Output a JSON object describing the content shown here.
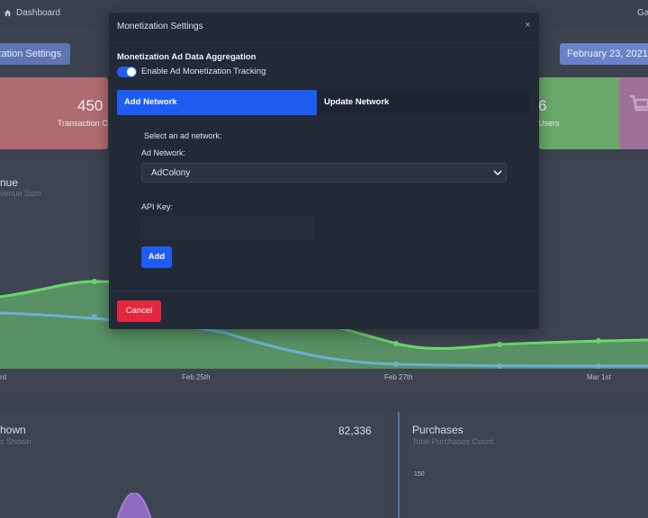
{
  "topbar": {
    "breadcrumb": "Dashboard",
    "right_text": "Ga"
  },
  "toolbar": {
    "aggregation_button": "zation Settings",
    "date_button": "February 23, 2021 - "
  },
  "cards": {
    "transactions": {
      "value": "450",
      "label": "Transaction C"
    },
    "users": {
      "value": "6",
      "label": "Users"
    }
  },
  "revenue_chart": {
    "title": "nue",
    "subtitle": "venue Sum",
    "x_labels": [
      "rd",
      "Feb 25th",
      "Feb 27th",
      "Mar 1st"
    ]
  },
  "shown_panel": {
    "title": "hown",
    "subtitle": "s Shown",
    "value": "82,336"
  },
  "purchases_panel": {
    "title": "Purchases",
    "subtitle": "Total Purchases Count",
    "tick": "150"
  },
  "modal": {
    "title": "Monetization Settings",
    "close": "×",
    "section_title": "Monetization Ad Data Aggregation",
    "toggle_label": "Enable Ad Monetization Tracking",
    "toggle_on": true,
    "tabs": [
      "Add Network",
      "Update Network"
    ],
    "select_prompt": "Select an ad network:",
    "network_label": "Ad Network:",
    "network_value": "AdColony",
    "api_key_label": "API Key:",
    "api_key_value": "",
    "add_button": "Add",
    "cancel_button": "Cancel"
  },
  "colors": {
    "accent": "#1f5cf2",
    "danger": "#e5273e",
    "modal_bg": "#222a38"
  }
}
